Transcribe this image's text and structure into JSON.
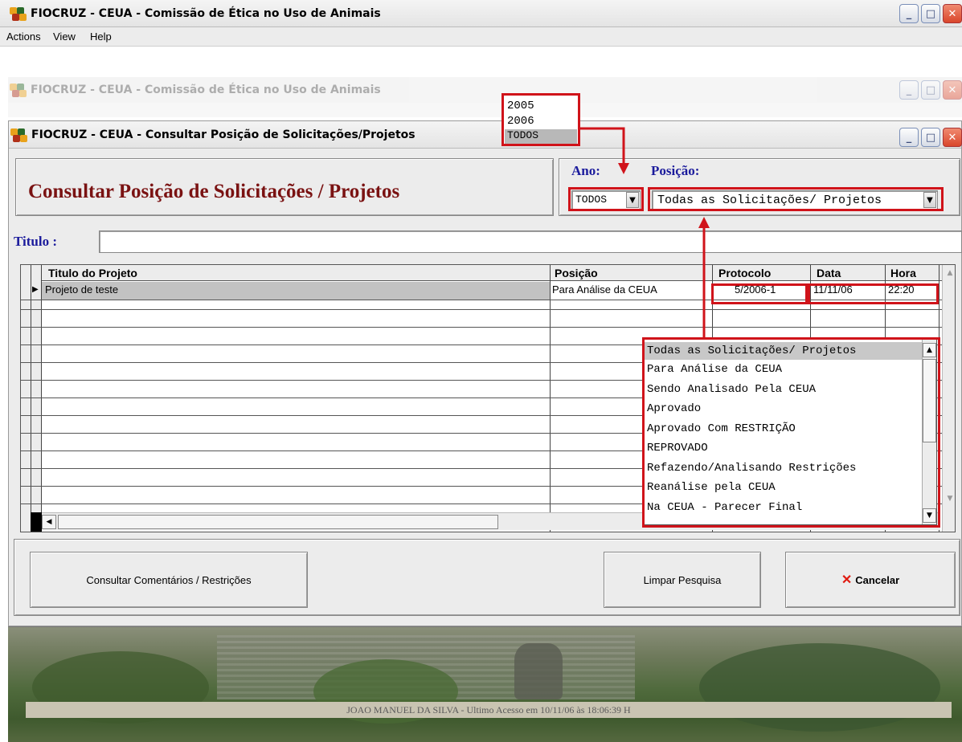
{
  "main_window": {
    "title": "FIOCRUZ - CEUA - Comissão de Ética no Uso de Animais"
  },
  "menu": [
    "Actions",
    "View",
    "Help"
  ],
  "bg_window": {
    "title": "FIOCRUZ - CEUA - Comissão de Ética no Uso de Animais"
  },
  "dialog": {
    "title": "FIOCRUZ - CEUA - Consultar Posição de Solicitações/Projetos",
    "heading": "Consultar Posição de Solicitações / Projetos",
    "ano_label": "Ano:",
    "ano_value": "TODOS",
    "posicao_label": "Posição:",
    "posicao_value": "Todas as Solicitações/ Projetos",
    "titulo_label": "Titulo :",
    "titulo_value": ""
  },
  "ano_dropdown": {
    "options": [
      "2005",
      "2006",
      "TODOS"
    ],
    "selected": "TODOS"
  },
  "table": {
    "columns": [
      "Titulo do Projeto",
      "Posição",
      "Protocolo",
      "Data",
      "Hora"
    ],
    "rows": [
      {
        "titulo": "Projeto de teste",
        "posicao": "Para Análise da CEUA",
        "protocolo": "5/2006-1",
        "data": "11/11/06",
        "hora": "22:20"
      }
    ]
  },
  "posicao_dropdown": {
    "options": [
      "Todas as Solicitações/ Projetos",
      "Para Análise da CEUA",
      "Sendo Analisado Pela CEUA",
      "Aprovado",
      "Aprovado Com RESTRIÇÃO",
      "REPROVADO",
      "Refazendo/Analisando Restrições",
      "Reanálise pela CEUA",
      "Na CEUA - Parecer Final"
    ],
    "selected": "Todas as Solicitações/ Projetos"
  },
  "buttons": {
    "comentarios": "Consultar Comentários / Restrições",
    "limpar": "Limpar Pesquisa",
    "cancelar": "Cancelar"
  },
  "status": "JOAO MANUEL DA SILVA - Ultimo Acesso em 10/11/06 às 18:06:39 H",
  "colors": {
    "heading": "#7a1212",
    "label_blue": "#1b1b9c",
    "annotation_red": "#d0131a"
  },
  "icons": [
    "app-icon",
    "minimize-icon",
    "maximize-icon",
    "close-icon",
    "dropdown-arrow-icon",
    "row-pointer-icon",
    "scroll-up-icon",
    "scroll-down-icon",
    "scroll-left-icon",
    "cancel-x-icon"
  ]
}
